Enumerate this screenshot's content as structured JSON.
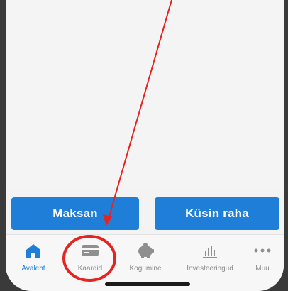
{
  "actions": {
    "pay_label": "Maksan",
    "request_label": "Küsin raha"
  },
  "tabs": [
    {
      "label": "Avaleht",
      "icon": "home-icon",
      "active": true
    },
    {
      "label": "Kaardid",
      "icon": "card-icon",
      "active": false
    },
    {
      "label": "Kogumine",
      "icon": "piggy-bank-icon",
      "active": false
    },
    {
      "label": "Investeeringud",
      "icon": "bar-chart-icon",
      "active": false
    },
    {
      "label": "Muu",
      "icon": "more-dots-icon",
      "active": false
    }
  ],
  "colors": {
    "accent": "#1f7fd8",
    "inactive": "#8a8a8a",
    "annotation": "#e52421"
  }
}
